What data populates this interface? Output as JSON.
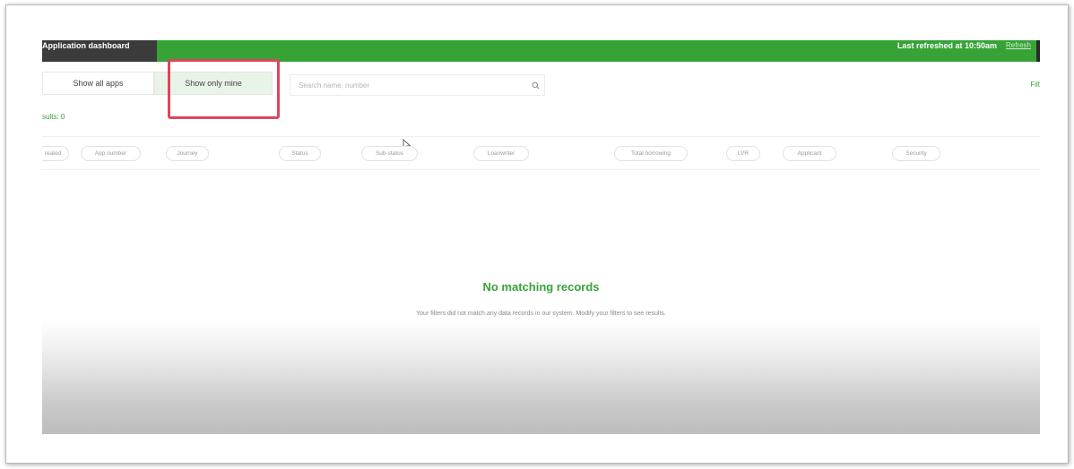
{
  "topbar": {
    "title": "Application dashboard",
    "last_refreshed": "Last refreshed at 10:50am",
    "refresh_label": "Refresh"
  },
  "toggles": {
    "show_all_label": "Show all apps",
    "show_mine_label": "Show only mine"
  },
  "search": {
    "placeholder": "Search name, number",
    "value": ""
  },
  "filters_label": "Filt",
  "results_label": "sults: 0",
  "columns": [
    "reated",
    "App number",
    "Journey",
    "Status",
    "Sub-status",
    "Loanwriter",
    "Total borrowing",
    "LVR",
    "Applicant",
    "Security"
  ],
  "empty_state": {
    "title": "No matching records",
    "description": "Your filters did not match any data records in our system. Modify your filters to see results."
  },
  "colors": {
    "accent": "#37a337",
    "dark_header": "#3b3b3b",
    "highlight": "#e0455b",
    "selected_toggle": "#e8f4e8"
  }
}
